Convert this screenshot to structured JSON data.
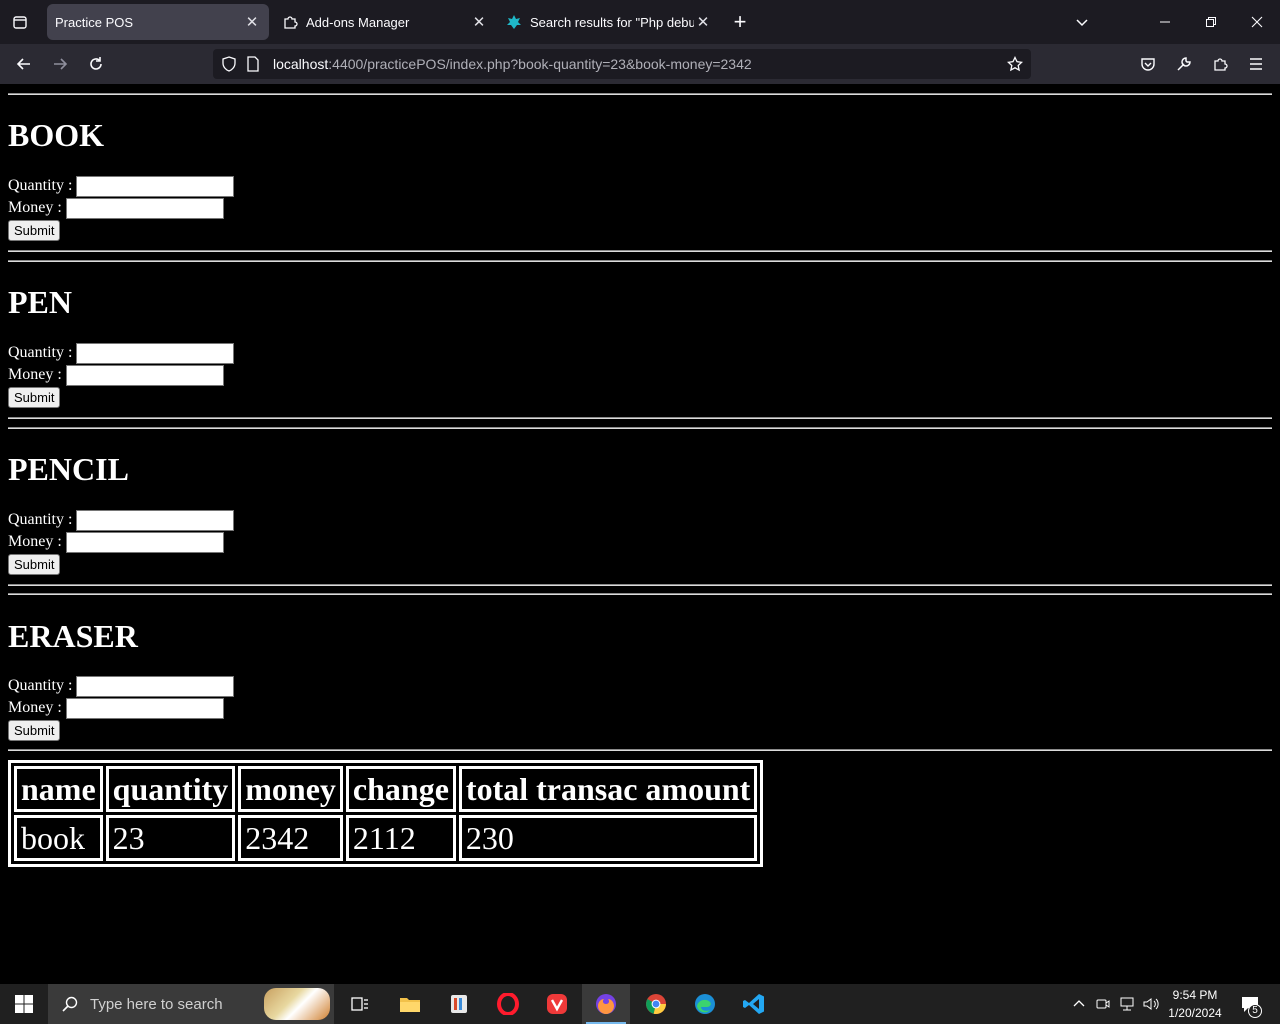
{
  "browser": {
    "tabs": [
      {
        "title": "Practice POS",
        "active": true
      },
      {
        "title": "Add-ons Manager",
        "active": false
      },
      {
        "title": "Search results for \"Php debugg",
        "active": false
      }
    ],
    "url_host": "localhost",
    "url_rest": ":4400/practicePOS/index.php?book-quantity=23&book-money=2342"
  },
  "page": {
    "products": [
      {
        "name": "BOOK",
        "quantity_label": "Quantity :",
        "money_label": "Money :",
        "quantity_value": "",
        "money_value": "",
        "submit_label": "Submit Query"
      },
      {
        "name": "PEN",
        "quantity_label": "Quantity :",
        "money_label": "Money :",
        "quantity_value": "",
        "money_value": "",
        "submit_label": "Submit Query"
      },
      {
        "name": "PENCIL",
        "quantity_label": "Quantity :",
        "money_label": "Money :",
        "quantity_value": "",
        "money_value": "",
        "submit_label": "Submit Query"
      },
      {
        "name": "ERASER",
        "quantity_label": "Quantity :",
        "money_label": "Money :",
        "quantity_value": "",
        "money_value": "",
        "submit_label": "Submit Query"
      }
    ],
    "table": {
      "headers": [
        "name",
        "quantity",
        "money",
        "change",
        "total transac amount"
      ],
      "rows": [
        [
          "book",
          "23",
          "2342",
          "2112",
          "230"
        ]
      ]
    }
  },
  "taskbar": {
    "search_placeholder": "Type here to search",
    "time": "9:54 PM",
    "date": "1/20/2024",
    "notification_count": "5",
    "apps": [
      "task-view",
      "file-explorer",
      "notepad-editor",
      "opera",
      "vivaldi",
      "firefox",
      "chrome",
      "edge",
      "vscode"
    ]
  },
  "colors": {
    "page_background": "#000000",
    "page_text": "#ffffff",
    "tab_active": "#42414d",
    "chrome_dark": "#1c1b22",
    "taskbar": "#202020"
  }
}
